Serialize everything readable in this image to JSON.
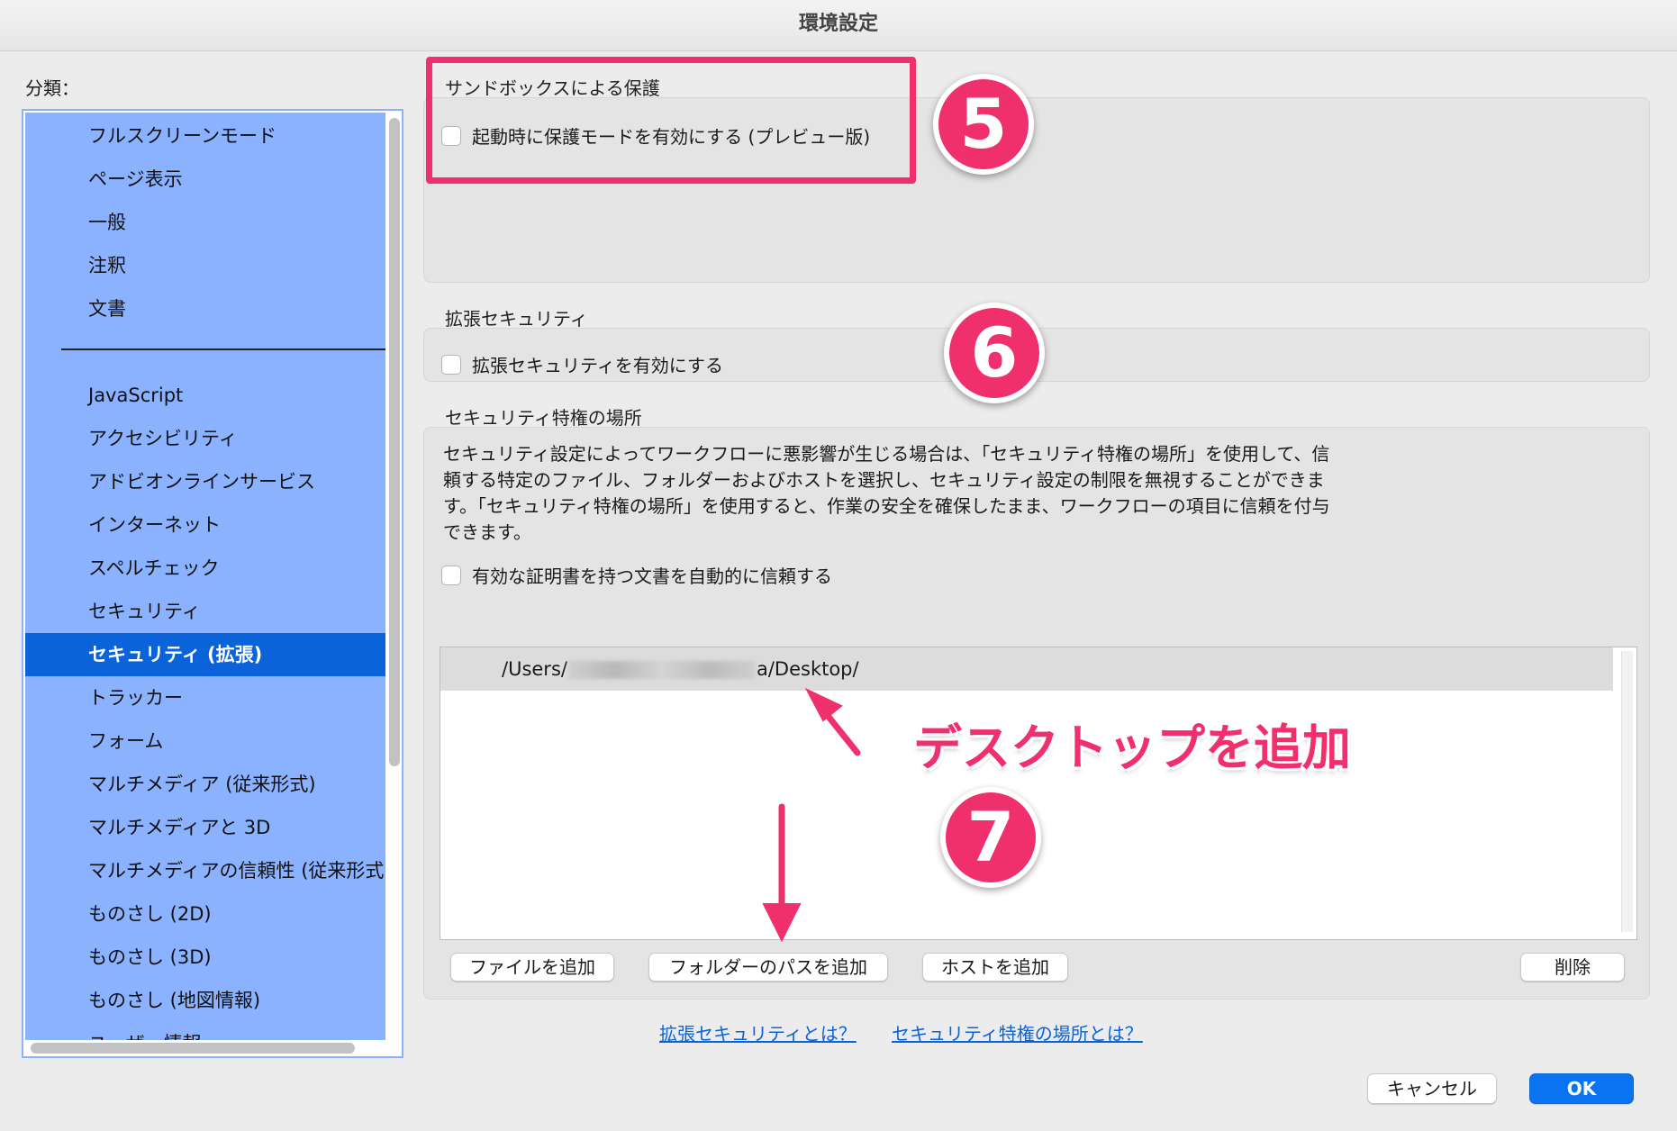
{
  "window": {
    "title": "環境設定"
  },
  "sidebar": {
    "label": "分類：",
    "items_top": [
      "フルスクリーンモード",
      "ページ表示",
      "一般",
      "注釈",
      "文書"
    ],
    "items_bottom": [
      "JavaScript",
      "アクセシビリティ",
      "アドビオンラインサービス",
      "インターネット",
      "スペルチェック",
      "セキュリティ",
      "セキュリティ (拡張)",
      "トラッカー",
      "フォーム",
      "マルチメディア (従来形式)",
      "マルチメディアと 3D",
      "マルチメディアの信頼性 (従来形式)",
      "ものさし (2D)",
      "ものさし (3D)",
      "ものさし (地図情報)",
      "ユーザー情報"
    ],
    "selected": "セキュリティ (拡張)"
  },
  "sandbox": {
    "title": "サンドボックスによる保護",
    "checkbox_label": "起動時に保護モードを有効にする (プレビュー版)"
  },
  "enhanced": {
    "title": "拡張セキュリティ",
    "checkbox_label": "拡張セキュリティを有効にする"
  },
  "privileged": {
    "title": "セキュリティ特権の場所",
    "description": "セキュリティ設定によってワークフローに悪影響が生じる場合は、「セキュリティ特権の場所」を使用して、信頼する特定のファイル、フォルダーおよびホストを選択し、セキュリティ設定の制限を無視することができます。「セキュリティ特権の場所」を使用すると、作業の安全を確保したまま、ワークフローの項目に信頼を付与できます。",
    "checkbox_label": "有効な証明書を持つ文書を自動的に信頼する",
    "path_prefix": "/Users/",
    "path_suffix": "a/Desktop/"
  },
  "buttons": {
    "add_file": "ファイルを追加",
    "add_folder": "フォルダーのパスを追加",
    "add_host": "ホストを追加",
    "delete": "削除",
    "cancel": "キャンセル",
    "ok": "OK"
  },
  "links": {
    "enhanced_help": "拡張セキュリティとは？",
    "privileged_help": "セキュリティ特権の場所とは？"
  },
  "annotations": {
    "step5": "5",
    "step6": "6",
    "step7": "7",
    "callout": "デスクトップを追加",
    "color": "#f0306c"
  },
  "colors": {
    "selection": "#0b63d9",
    "sidebar_bg": "#8ab2ff",
    "ok_button": "#0a74f0"
  }
}
